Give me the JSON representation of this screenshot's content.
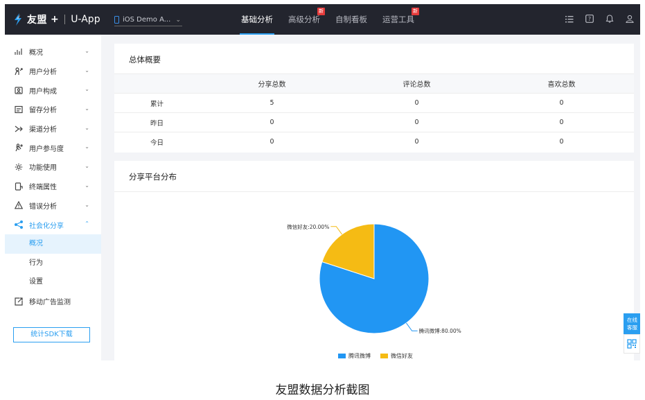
{
  "topbar": {
    "brand": "友盟",
    "plus": "+",
    "app_name": "U-App",
    "app_select": "iOS Demo A...",
    "nav": [
      {
        "label": "基础分析",
        "active": true,
        "badge": ""
      },
      {
        "label": "高级分析",
        "active": false,
        "badge": "新"
      },
      {
        "label": "自制看板",
        "active": false,
        "badge": ""
      },
      {
        "label": "运营工具",
        "active": false,
        "badge": "新"
      }
    ],
    "icons": [
      "list-icon",
      "help-icon",
      "bell-icon",
      "user-icon"
    ]
  },
  "sidebar": {
    "items": [
      {
        "label": "概况",
        "icon": "overview-icon"
      },
      {
        "label": "用户分析",
        "icon": "user-analysis-icon"
      },
      {
        "label": "用户构成",
        "icon": "user-composition-icon"
      },
      {
        "label": "留存分析",
        "icon": "retention-icon"
      },
      {
        "label": "渠道分析",
        "icon": "channel-icon"
      },
      {
        "label": "用户参与度",
        "icon": "engagement-icon"
      },
      {
        "label": "功能使用",
        "icon": "gear-icon"
      },
      {
        "label": "终端属性",
        "icon": "device-icon"
      },
      {
        "label": "错误分析",
        "icon": "warning-icon"
      },
      {
        "label": "社会化分享",
        "icon": "share-icon"
      }
    ],
    "sub_items": [
      "概况",
      "行为",
      "设置"
    ],
    "extra_item": "移动广告监测",
    "sdk_button": "统计SDK下载"
  },
  "summary": {
    "title": "总体概要",
    "columns": [
      "分享总数",
      "评论总数",
      "喜欢总数"
    ],
    "rows": [
      {
        "label": "累计",
        "values": [
          "5",
          "0",
          "0"
        ]
      },
      {
        "label": "昨日",
        "values": [
          "0",
          "0",
          "0"
        ]
      },
      {
        "label": "今日",
        "values": [
          "0",
          "0",
          "0"
        ]
      }
    ]
  },
  "distribution": {
    "title": "分享平台分布"
  },
  "chart_data": {
    "type": "pie",
    "series": [
      {
        "name": "腾讯微博",
        "value": 80.0,
        "label": "腾讯微博:80.00%",
        "color": "#2196f3"
      },
      {
        "name": "微信好友",
        "value": 20.0,
        "label": "微信好友:20.00%",
        "color": "#f5bb14"
      }
    ],
    "legend": "bottom"
  },
  "float_tab": {
    "line1": "在线",
    "line2": "客服"
  },
  "caption": "友盟数据分析截图",
  "colors": {
    "accent": "#2a9ef0",
    "topbar": "#23252e",
    "badge": "#e63b3b"
  }
}
